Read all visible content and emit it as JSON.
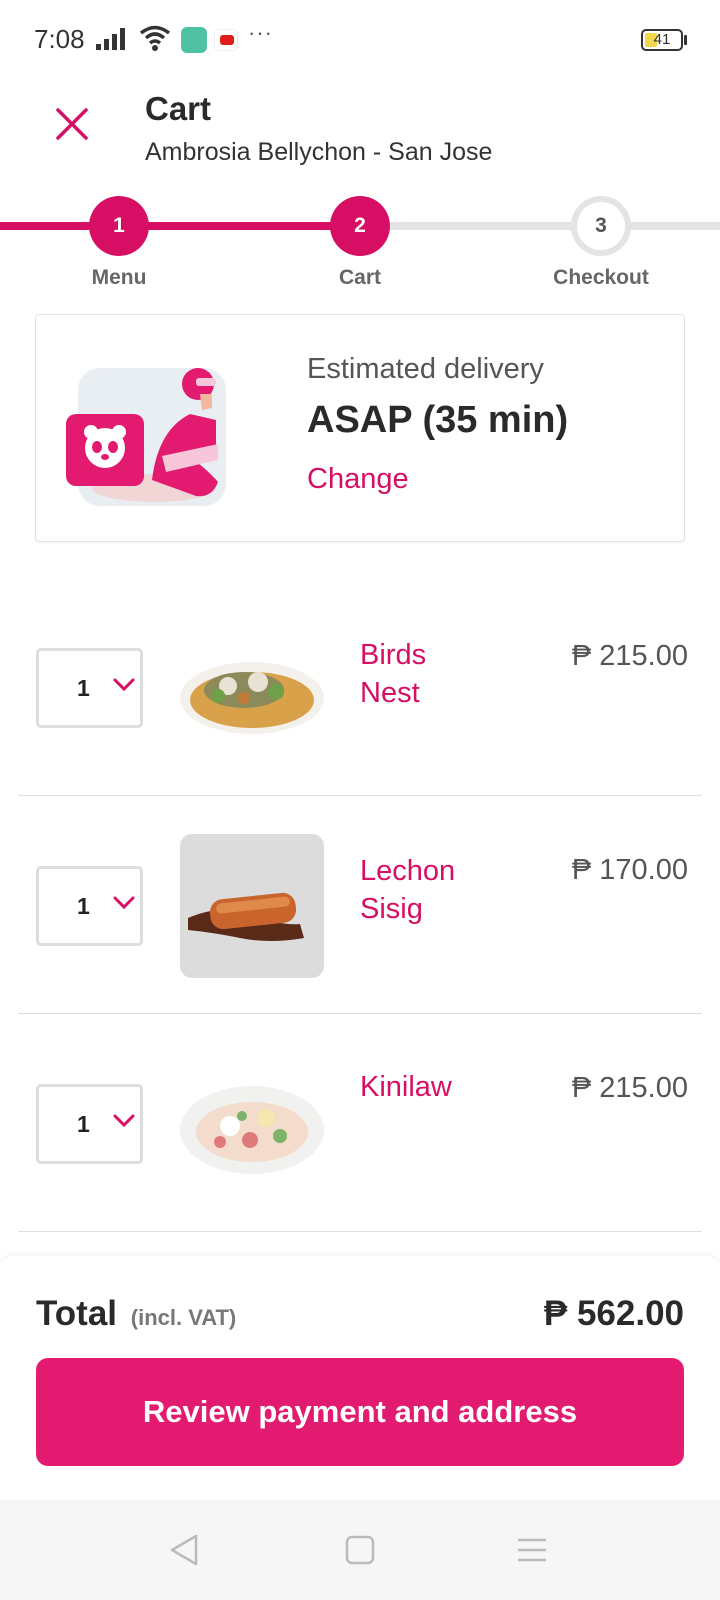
{
  "status_bar": {
    "time": "7:08",
    "more": "···",
    "battery_level": "41",
    "icons": [
      "signal-icon",
      "wifi-icon",
      "app-notification-icon",
      "youtube-icon",
      "battery-icon"
    ]
  },
  "header": {
    "title": "Cart",
    "subtitle": "Ambrosia Bellychon - San Jose",
    "close_icon": "close-icon"
  },
  "stepper": {
    "current_step": 2,
    "steps": [
      {
        "number": "1",
        "label": "Menu",
        "state": "done"
      },
      {
        "number": "2",
        "label": "Cart",
        "state": "current"
      },
      {
        "number": "3",
        "label": "Checkout",
        "state": "todo"
      }
    ]
  },
  "delivery": {
    "label": "Estimated delivery",
    "time": "ASAP (35 min)",
    "change_label": "Change",
    "illustration": "delivery-rider-panda-illustration"
  },
  "cart": {
    "items": [
      {
        "quantity": "1",
        "name_line1": "Birds",
        "name_line2": "Nest",
        "price": "₱ 215.00"
      },
      {
        "quantity": "1",
        "name_line1": "Lechon",
        "name_line2": "Sisig",
        "price": "₱ 170.00"
      },
      {
        "quantity": "1",
        "name_line1": "Kinilaw",
        "name_line2": "",
        "price": "₱ 215.00"
      }
    ]
  },
  "footer": {
    "total_label": "Total",
    "total_vat": "(incl. VAT)",
    "total_value": "₱ 562.00",
    "button_label": "Review payment and address"
  },
  "colors": {
    "brand": "#d70f64",
    "button": "#e21b70",
    "inactive": "#e4e4e4"
  },
  "nav_bar": {
    "icons": [
      "back-icon",
      "home-icon",
      "menu-icon"
    ]
  }
}
